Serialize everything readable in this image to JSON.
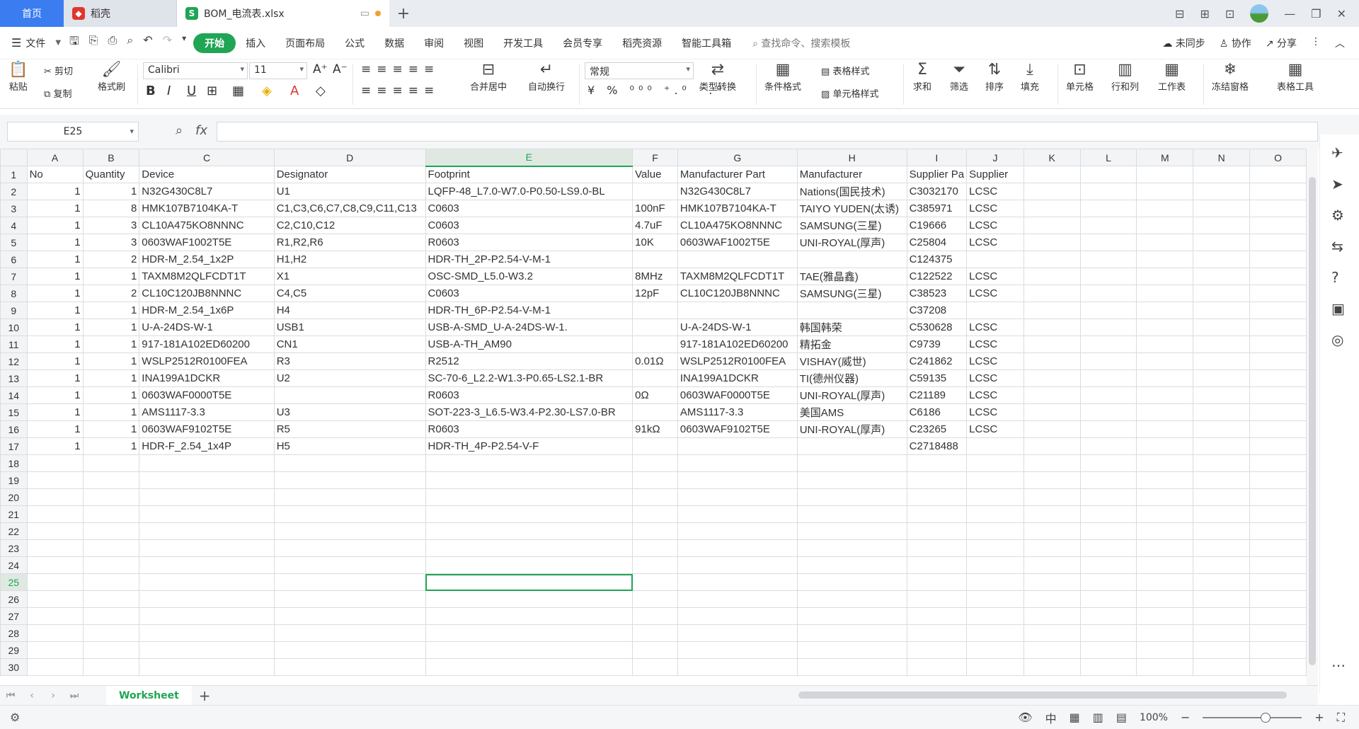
{
  "titlebar": {
    "home_tab": "首页",
    "docer_tab": "稻壳",
    "file_tab": "BOM_电流表.xlsx"
  },
  "menubar": {
    "file_menu": "文件",
    "items": [
      "开始",
      "插入",
      "页面布局",
      "公式",
      "数据",
      "审阅",
      "视图",
      "开发工具",
      "会员专享",
      "稻壳资源",
      "智能工具箱"
    ],
    "search_placeholder": "查找命令、搜索模板",
    "sync": "未同步",
    "collab": "协作",
    "share": "分享"
  },
  "ribbon": {
    "paste": "粘贴",
    "cut": "剪切",
    "copy": "复制",
    "format_painter": "格式刷",
    "font_name": "Calibri",
    "font_size": "11",
    "merge_center": "合并居中",
    "wrap_text": "自动换行",
    "number_format": "常规",
    "type_convert": "类型转换",
    "cond_format": "条件格式",
    "table_style": "表格样式",
    "cell_style": "单元格样式",
    "sum": "求和",
    "filter": "筛选",
    "sort": "排序",
    "fill": "填充",
    "cell": "单元格",
    "rowcol": "行和列",
    "worksheet": "工作表",
    "freeze": "冻结窗格",
    "table_tools": "表格工具"
  },
  "formula_bar": {
    "name_box": "E25",
    "fx_label": "fx",
    "formula": ""
  },
  "grid": {
    "columns": [
      "A",
      "B",
      "C",
      "D",
      "E",
      "F",
      "G",
      "H",
      "I",
      "J",
      "K",
      "L",
      "M",
      "N",
      "O"
    ],
    "selected_column": "E",
    "selected_row": 25,
    "rows": [
      [
        "No",
        "Quantity",
        "Device",
        "Designator",
        "Footprint",
        "Value",
        "Manufacturer Part",
        "Manufacturer",
        "Supplier Pa",
        "Supplier"
      ],
      [
        "1",
        "1",
        "N32G430C8L7",
        "U1",
        "LQFP-48_L7.0-W7.0-P0.50-LS9.0-BL",
        "",
        "N32G430C8L7",
        "Nations(国民技术)",
        "C3032170",
        "LCSC"
      ],
      [
        "1",
        "8",
        "HMK107B7104KA-T",
        "C1,C3,C6,C7,C8,C9,C11,C13",
        "C0603",
        "100nF",
        "HMK107B7104KA-T",
        "TAIYO YUDEN(太诱)",
        "C385971",
        "LCSC"
      ],
      [
        "1",
        "3",
        "CL10A475KO8NNNC",
        "C2,C10,C12",
        "C0603",
        "4.7uF",
        "CL10A475KO8NNNC",
        "SAMSUNG(三星)",
        "C19666",
        "LCSC"
      ],
      [
        "1",
        "3",
        "0603WAF1002T5E",
        "R1,R2,R6",
        "R0603",
        "10K",
        "0603WAF1002T5E",
        "UNI-ROYAL(厚声)",
        "C25804",
        "LCSC"
      ],
      [
        "1",
        "2",
        "HDR-M_2.54_1x2P",
        "H1,H2",
        "HDR-TH_2P-P2.54-V-M-1",
        "",
        "",
        "",
        "C124375",
        ""
      ],
      [
        "1",
        "1",
        "TAXM8M2QLFCDT1T",
        "X1",
        "OSC-SMD_L5.0-W3.2",
        "8MHz",
        "TAXM8M2QLFCDT1T",
        "TAE(雅晶鑫)",
        "C122522",
        "LCSC"
      ],
      [
        "1",
        "2",
        "CL10C120JB8NNNC",
        "C4,C5",
        "C0603",
        "12pF",
        "CL10C120JB8NNNC",
        "SAMSUNG(三星)",
        "C38523",
        "LCSC"
      ],
      [
        "1",
        "1",
        "HDR-M_2.54_1x6P",
        "H4",
        "HDR-TH_6P-P2.54-V-M-1",
        "",
        "",
        "",
        "C37208",
        ""
      ],
      [
        "1",
        "1",
        "U-A-24DS-W-1",
        "USB1",
        "USB-A-SMD_U-A-24DS-W-1.",
        "",
        "U-A-24DS-W-1",
        "韩国韩荣",
        "C530628",
        "LCSC"
      ],
      [
        "1",
        "1",
        "917-181A102ED60200",
        "CN1",
        "USB-A-TH_AM90",
        "",
        "917-181A102ED60200",
        "精拓金",
        "C9739",
        "LCSC"
      ],
      [
        "1",
        "1",
        "WSLP2512R0100FEA",
        "R3",
        "R2512",
        "0.01Ω",
        "WSLP2512R0100FEA",
        "VISHAY(威世)",
        "C241862",
        "LCSC"
      ],
      [
        "1",
        "1",
        "INA199A1DCKR",
        "U2",
        "SC-70-6_L2.2-W1.3-P0.65-LS2.1-BR",
        "",
        "INA199A1DCKR",
        "TI(德州仪器)",
        "C59135",
        "LCSC"
      ],
      [
        "1",
        "1",
        "0603WAF0000T5E",
        "",
        "R0603",
        "0Ω",
        "0603WAF0000T5E",
        "UNI-ROYAL(厚声)",
        "C21189",
        "LCSC"
      ],
      [
        "1",
        "1",
        "AMS1117-3.3",
        "U3",
        "SOT-223-3_L6.5-W3.4-P2.30-LS7.0-BR",
        "",
        "AMS1117-3.3",
        "美国AMS",
        "C6186",
        "LCSC"
      ],
      [
        "1",
        "1",
        "0603WAF9102T5E",
        "R5",
        "R0603",
        "91kΩ",
        "0603WAF9102T5E",
        "UNI-ROYAL(厚声)",
        "C23265",
        "LCSC"
      ],
      [
        "1",
        "1",
        "HDR-F_2.54_1x4P",
        "H5",
        "HDR-TH_4P-P2.54-V-F",
        "",
        "",
        "",
        "C2718488",
        ""
      ]
    ],
    "total_visible_rows": 30
  },
  "sheet_tabs": {
    "active": "Worksheet"
  },
  "statusbar": {
    "zoom": "100%"
  },
  "colors": {
    "accent": "#1fa554",
    "home_tab": "#3b7df0",
    "grid_line": "#dadcdf"
  }
}
